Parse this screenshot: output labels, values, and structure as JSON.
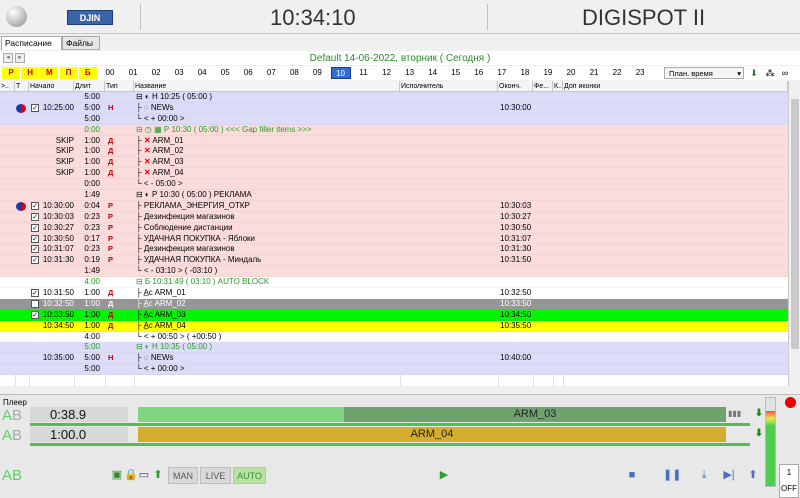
{
  "header": {
    "logo": "DJIN",
    "clock": "10:34:10",
    "brand": "DIGISPOT II"
  },
  "tabs": [
    {
      "label": "Расписание"
    },
    {
      "label": "Файлы"
    }
  ],
  "nav": {
    "prev": "◂",
    "next": "▸",
    "date": "Default 14-06-2022, вторник ( Сегодня )"
  },
  "flags": [
    "Р",
    "Н",
    "М",
    "П",
    "Б"
  ],
  "hours": [
    "00",
    "01",
    "02",
    "03",
    "04",
    "05",
    "06",
    "07",
    "08",
    "09",
    "10",
    "11",
    "12",
    "13",
    "14",
    "15",
    "16",
    "17",
    "18",
    "19",
    "20",
    "21",
    "22",
    "23"
  ],
  "current_hour": "10",
  "plan_select": "План. время",
  "columns": {
    "c0": ">..",
    "c1": "Т",
    "start": "Начало",
    "dur": "Длит",
    "type": "Тип",
    "name": "Название",
    "artist": "Исполнитель",
    "end": "Оконч.",
    "fe": "Фе...",
    "k": "К...",
    "extra": "Доп иконки"
  },
  "rows": [
    {
      "cls": "rb",
      "start": "",
      "dur": "5:00",
      "type": "",
      "name": "⊟ ◐ Н 10:25 ( 05:00 )",
      "end": "",
      "icon": false,
      "chk": false
    },
    {
      "cls": "rb",
      "start": "10:25:00",
      "dur": "5:00",
      "type": "Н",
      "name": "├ ◌ NEWs",
      "end": "10:30:00",
      "icon": true,
      "chk": true
    },
    {
      "cls": "rb",
      "start": "",
      "dur": "5:00",
      "type": "",
      "name": "└ < + 00:00 >",
      "end": "",
      "icon": false,
      "chk": false
    },
    {
      "cls": "rp",
      "start": "",
      "dur": "0:00",
      "type": "",
      "name": "⊟ ◷ ▦ Р 10:30 ( 05:00 ) <<< Gap filler items >>>",
      "end": "",
      "icon": false,
      "chk": false,
      "green": true
    },
    {
      "cls": "rp",
      "start": "SKIP",
      "dur": "1:00",
      "type": "Д",
      "name": "├ ✕ ARM_01",
      "end": "",
      "icon": false,
      "chk": false
    },
    {
      "cls": "rp",
      "start": "SKIP",
      "dur": "1:00",
      "type": "Д",
      "name": "├ ✕ ARM_02",
      "end": "",
      "icon": false,
      "chk": false
    },
    {
      "cls": "rp",
      "start": "SKIP",
      "dur": "1:00",
      "type": "Д",
      "name": "├ ✕ ARM_03",
      "end": "",
      "icon": false,
      "chk": false
    },
    {
      "cls": "rp",
      "start": "SKIP",
      "dur": "1:00",
      "type": "Д",
      "name": "├ ✕ ARM_04",
      "end": "",
      "icon": false,
      "chk": false
    },
    {
      "cls": "rp",
      "start": "",
      "dur": "0:00",
      "type": "",
      "name": "└ < - 05:00 >",
      "end": "",
      "icon": false,
      "chk": false
    },
    {
      "cls": "rp",
      "start": "",
      "dur": "1:49",
      "type": "",
      "name": "⊟ ◐ Р 10:30 ( 05:00 ) РЕКЛАМА",
      "end": "",
      "icon": false,
      "chk": false
    },
    {
      "cls": "rp",
      "start": "10:30:00",
      "dur": "0:04",
      "type": "Р",
      "name": "├ РЕКЛАМА_ЭНЕРГИЯ_ОТКР",
      "end": "10:30:03",
      "icon": true,
      "chk": true
    },
    {
      "cls": "rp",
      "start": "10:30:03",
      "dur": "0:23",
      "type": "Р",
      "name": "├ Дезинфекция магазинов",
      "end": "10:30:27",
      "icon": false,
      "chk": true
    },
    {
      "cls": "rp",
      "start": "10:30:27",
      "dur": "0:23",
      "type": "Р",
      "name": "├ Соблюдение дистанции",
      "end": "10:30:50",
      "icon": false,
      "chk": true
    },
    {
      "cls": "rp",
      "start": "10:30:50",
      "dur": "0:17",
      "type": "Р",
      "name": "├ УДАЧНАЯ ПОКУПКА - Яблоки",
      "end": "10:31:07",
      "icon": false,
      "chk": true
    },
    {
      "cls": "rp",
      "start": "10:31:07",
      "dur": "0:23",
      "type": "Р",
      "name": "├ Дезинфекция магазинов",
      "end": "10:31:30",
      "icon": false,
      "chk": true
    },
    {
      "cls": "rp",
      "start": "10:31:30",
      "dur": "0:19",
      "type": "Р",
      "name": "├ УДАЧНАЯ ПОКУПКА - Миндаль",
      "end": "10:31:50",
      "icon": false,
      "chk": true
    },
    {
      "cls": "rp",
      "start": "",
      "dur": "1:49",
      "type": "",
      "name": "└ < - 03:10 > ( -03:10 )",
      "end": "",
      "icon": false,
      "chk": false
    },
    {
      "cls": "rw",
      "start": "",
      "dur": "4:00",
      "type": "",
      "name": "⊟      Б 10:31:49 ( 03:10 ) AUTO BLOCK",
      "end": "",
      "icon": false,
      "chk": false,
      "green": true
    },
    {
      "cls": "rw",
      "start": "10:31:50",
      "dur": "1:00",
      "type": "Д",
      "name": "├ A̲c ARM_01",
      "end": "10:32:50",
      "icon": false,
      "chk": true
    },
    {
      "cls": "rg",
      "start": "10:32:50",
      "dur": "1:00",
      "type": "Д",
      "name": "├ A̲c ARM_02",
      "end": "10:33:50",
      "icon": false,
      "chk": true
    },
    {
      "cls": "rgr",
      "start": "10:33:50",
      "dur": "1:00",
      "type": "Д",
      "name": "├ A̲c ARM_03",
      "end": "10:34:50",
      "icon": false,
      "chk": true
    },
    {
      "cls": "ry",
      "start": "10:34:50",
      "dur": "1:00",
      "type": "Д",
      "name": "├ A̲c ARM_04",
      "end": "10:35:50",
      "icon": false,
      "chk": false
    },
    {
      "cls": "rw",
      "start": "",
      "dur": "4:00",
      "type": "",
      "name": "└ < + 00:50 > ( +00:50 )",
      "end": "",
      "icon": false,
      "chk": false
    },
    {
      "cls": "rb",
      "start": "",
      "dur": "5:00",
      "type": "",
      "name": "⊟ ◐ Н 10:35 ( 05:00 )",
      "end": "",
      "icon": false,
      "chk": false,
      "green": true
    },
    {
      "cls": "rb",
      "start": "10:35:00",
      "dur": "5:00",
      "type": "Н",
      "name": "├ ◌ NEWs",
      "end": "10:40:00",
      "icon": false,
      "chk": false
    },
    {
      "cls": "rb",
      "start": "",
      "dur": "5:00",
      "type": "",
      "name": "└ < + 00:00 >",
      "end": "",
      "icon": false,
      "chk": false
    }
  ],
  "player": {
    "label": "Плеер",
    "a": "A",
    "b": "B",
    "track1": {
      "time": "0:38.9",
      "name": "ARM_03",
      "progress": 0.3
    },
    "track2": {
      "time": "1:00.0",
      "name": "ARM_04",
      "progress": 0.0
    },
    "buttons": {
      "man": "MAN",
      "live": "LIVE",
      "auto": "AUTO"
    },
    "counter": "1",
    "off": "OFF"
  }
}
